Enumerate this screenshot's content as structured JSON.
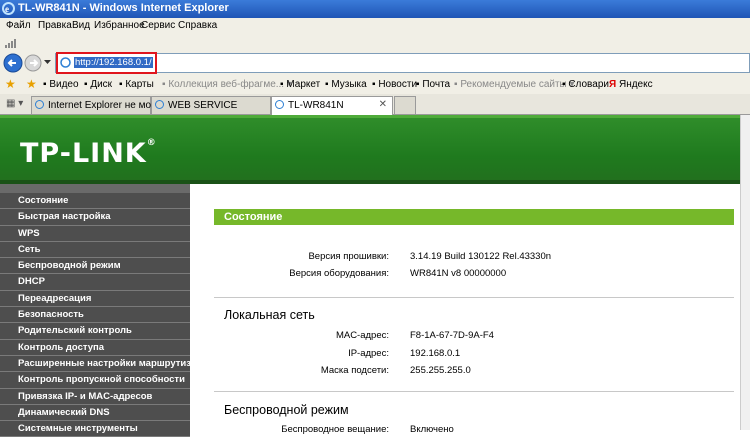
{
  "window": {
    "title": "TL-WR841N - Windows Internet Explorer"
  },
  "menu": [
    "Файл",
    "Правка",
    "Вид",
    "Избранное",
    "Сервис",
    "Справка"
  ],
  "address": {
    "url": "http://192.168.0.1/"
  },
  "favorites": [
    "Видео",
    "Диск",
    "Карты",
    "Коллекция веб-фрагме...",
    "Маркет",
    "Музыка",
    "Новости",
    "Почта",
    "Рекомендуемые сайты",
    "Словари",
    "Яндекс"
  ],
  "tabs": [
    "Internet Explorer не может ...",
    "WEB SERVICE",
    "TL-WR841N"
  ],
  "router": {
    "logo": "TP-LINK",
    "nav": [
      "Состояние",
      "Быстрая настройка",
      "WPS",
      "Сеть",
      "Беспроводной режим",
      "DHCP",
      "Переадресация",
      "Безопасность",
      "Родительский контроль",
      "Контроль доступа",
      "Расширенные настройки маршрутизации",
      "Контроль пропускной способности",
      "Привязка IP- и MAC-адресов",
      "Динамический DNS",
      "Системные инструменты"
    ],
    "section_title": "Состояние",
    "firmware_label": "Версия прошивки:",
    "firmware_value": "3.14.19 Build 130122 Rel.43330n",
    "hardware_label": "Версия оборудования:",
    "hardware_value": "WR841N v8 00000000",
    "lan_heading": "Локальная сеть",
    "mac_label": "MAC-адрес:",
    "mac_value": "F8-1A-67-7D-9A-F4",
    "ip_label": "IP-адрес:",
    "ip_value": "192.168.0.1",
    "mask_label": "Маска подсети:",
    "mask_value": "255.255.255.0",
    "wireless_heading": "Беспроводной режим",
    "radio_label": "Беспроводное вещание:",
    "radio_value": "Включено"
  },
  "colors": {
    "banner": "#1f7a1e",
    "section": "#76b82a",
    "highlight": "#e0151d"
  }
}
